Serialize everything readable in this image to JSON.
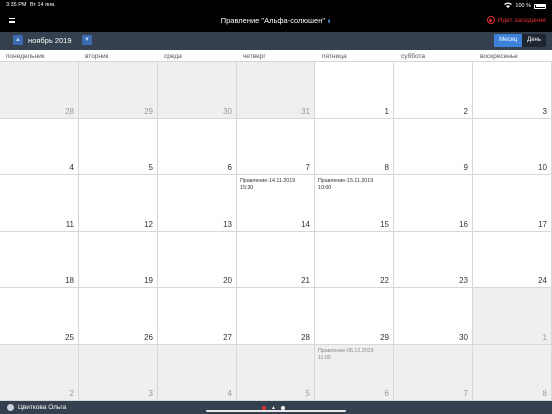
{
  "status_bar": {
    "time": "3:35 PM",
    "date": "Вт 14 янв.",
    "battery": "100 %"
  },
  "header": {
    "title": "Правление \"Альфа-солюшен\"",
    "meeting_status": "Идет заседание"
  },
  "toolbar": {
    "month_label": "ноябрь 2019",
    "view_month": "Месяц",
    "view_day": "День"
  },
  "weekdays": [
    "понедельник",
    "вторник",
    "среда",
    "четверг",
    "пятница",
    "суббота",
    "воскресенье"
  ],
  "weeks": [
    [
      {
        "day": "28",
        "other": true
      },
      {
        "day": "29",
        "other": true
      },
      {
        "day": "30",
        "other": true
      },
      {
        "day": "31",
        "other": true
      },
      {
        "day": "1"
      },
      {
        "day": "2"
      },
      {
        "day": "3"
      }
    ],
    [
      {
        "day": "4"
      },
      {
        "day": "5"
      },
      {
        "day": "6"
      },
      {
        "day": "7"
      },
      {
        "day": "8"
      },
      {
        "day": "9"
      },
      {
        "day": "10"
      }
    ],
    [
      {
        "day": "11"
      },
      {
        "day": "12"
      },
      {
        "day": "13"
      },
      {
        "day": "14",
        "event": "Правление-14.11.2019",
        "event_time": "15:30"
      },
      {
        "day": "15",
        "event": "Правление-15.11.2019",
        "event_time": "10:00"
      },
      {
        "day": "16"
      },
      {
        "day": "17"
      }
    ],
    [
      {
        "day": "18"
      },
      {
        "day": "19"
      },
      {
        "day": "20"
      },
      {
        "day": "21"
      },
      {
        "day": "22"
      },
      {
        "day": "23"
      },
      {
        "day": "24"
      }
    ],
    [
      {
        "day": "25"
      },
      {
        "day": "26"
      },
      {
        "day": "27"
      },
      {
        "day": "28"
      },
      {
        "day": "29"
      },
      {
        "day": "30"
      },
      {
        "day": "1",
        "other": true
      }
    ],
    [
      {
        "day": "2",
        "other": true
      },
      {
        "day": "3",
        "other": true
      },
      {
        "day": "4",
        "other": true
      },
      {
        "day": "5",
        "other": true
      },
      {
        "day": "6",
        "other": true,
        "event": "Правление-06.12.2019",
        "event_time": "11:00"
      },
      {
        "day": "7",
        "other": true
      },
      {
        "day": "8",
        "other": true
      }
    ]
  ],
  "footer": {
    "user_name": "Цвиткова Ольга"
  }
}
